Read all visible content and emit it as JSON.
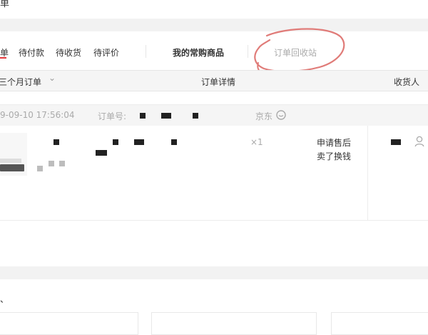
{
  "page": {
    "title_fragment": "单"
  },
  "tabs": {
    "active": "单",
    "pending_payment": "待付款",
    "pending_receipt": "待收货",
    "pending_review": "待评价",
    "frequent_products": "我的常购商品",
    "recycle_bin": "订单回收站"
  },
  "order_table": {
    "filter_label": "三个月订单",
    "filter_chevron": "⌄",
    "col_details": "订单详情",
    "col_receiver": "收货人"
  },
  "order": {
    "datetime": "9-09-10 17:56:04",
    "number_label": "订单号:",
    "shop": "京东",
    "shop_icon": "chat-bubble",
    "quantity": "×1",
    "action_after_sale": "申请售后",
    "action_trade_in": "卖了换钱"
  },
  "colors": {
    "accent_red": "#e4393c",
    "annotation_stroke": "#e07b78"
  },
  "bottom": {
    "fragment": "、"
  }
}
